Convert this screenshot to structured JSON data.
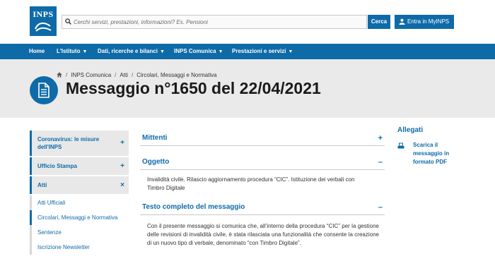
{
  "header": {
    "logo_text": "INPS",
    "search_placeholder": "Cerchi servizi, prestazioni, informazioni? Es. Pensioni",
    "search_button": "Cerca",
    "login_button": "Entra in MyINPS"
  },
  "nav": {
    "items": [
      {
        "label": "Home"
      },
      {
        "label": "L'Istituto"
      },
      {
        "label": "Dati, ricerche e bilanci"
      },
      {
        "label": "INPS Comunica"
      },
      {
        "label": "Prestazioni e servizi"
      }
    ]
  },
  "breadcrumb": [
    "INPS Comunica",
    "Atti",
    "Circolari, Messaggi e Normativa"
  ],
  "page_title": "Messaggio n°1650 del 22/04/2021",
  "sidebar": {
    "sections": [
      {
        "label": "Coronavirus: le misure dell'INPS",
        "sign": "+"
      },
      {
        "label": "Ufficio Stampa",
        "sign": "+"
      },
      {
        "label": "Atti",
        "sign": "×"
      }
    ],
    "sub_items": [
      {
        "label": "Atti Ufficiali"
      },
      {
        "label": "Circolari, Messaggi e Normativa"
      },
      {
        "label": "Sentenze"
      },
      {
        "label": "Iscrizione Newsletter"
      }
    ]
  },
  "main": {
    "mittenti": {
      "title": "Mittenti",
      "sign": "+"
    },
    "oggetto": {
      "title": "Oggetto",
      "sign": "–",
      "body": "Invalidità civile. Rilascio aggiornamento procedura “CIC”. Istituzione dei verbali con Timbro Digitale"
    },
    "testo": {
      "title": "Testo completo del messaggio",
      "sign": "–",
      "body": "Con il presente messaggio si comunica che, all’interno della procedura “CIC” per la gestione delle revisioni di invalidità civile, è stata rilasciata una funzionalità che consente la creazione di un nuovo tipo di verbale, denominato “con Timbro Digitale”."
    }
  },
  "attachments": {
    "title": "Allegati",
    "items": [
      {
        "label": "Scarica il messaggio in formato PDF"
      }
    ]
  },
  "colors": {
    "brand": "#0e6ba8",
    "banner": "#eaeaea"
  }
}
